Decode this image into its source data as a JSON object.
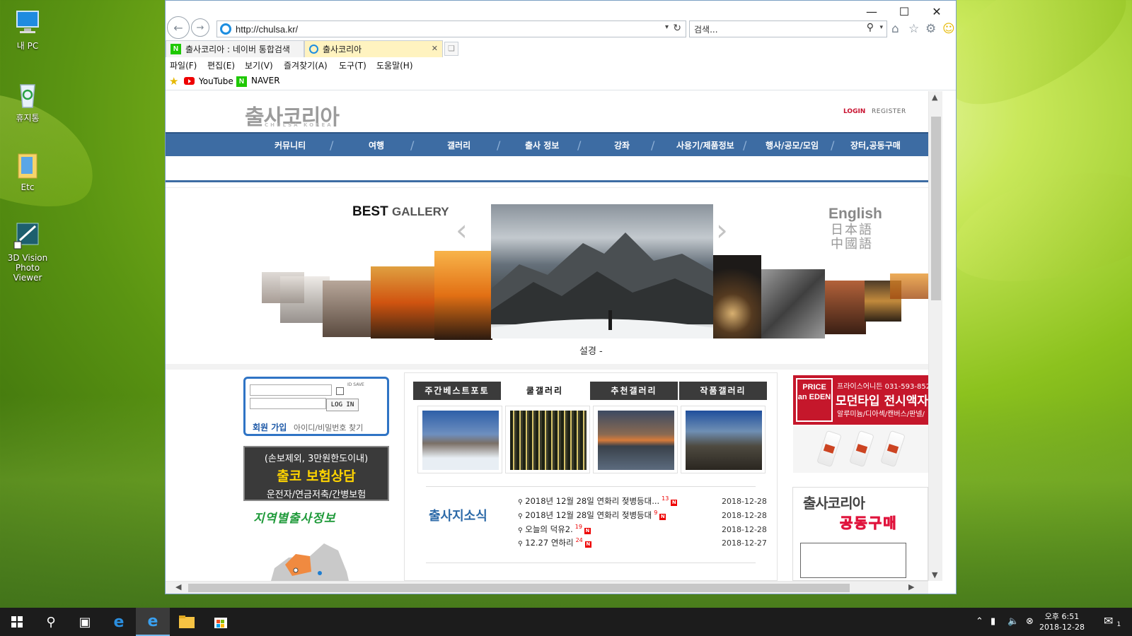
{
  "desktop": {
    "icons": [
      {
        "label": "내 PC",
        "icon": "monitor-icon"
      },
      {
        "label": "휴지통",
        "icon": "recycle-bin-icon"
      },
      {
        "label": "Etc",
        "icon": "folder-icon"
      },
      {
        "label": "3D Vision Photo Viewer",
        "icon": "3d-vision-icon"
      }
    ]
  },
  "browser": {
    "url": "http://chulsa.kr/",
    "search_placeholder": "검색...",
    "tabs": [
      {
        "label": "출사코리아 : 네이버 통합검색",
        "icon": "naver-icon",
        "active": false
      },
      {
        "label": "출사코리아",
        "icon": "ie-icon",
        "active": true
      }
    ],
    "menu": [
      "파일(F)",
      "편집(E)",
      "보기(V)",
      "즐겨찾기(A)",
      "도구(T)",
      "도움말(H)"
    ],
    "favorites": [
      {
        "label": "YouTube",
        "icon": "youtube-icon"
      },
      {
        "label": "NAVER",
        "icon": "naver-icon"
      }
    ]
  },
  "site": {
    "logo": "출사코리아",
    "logo_sub": "CHULSA KOREA",
    "login_link": "LOGIN",
    "register_link": "REGISTER",
    "nav": [
      "커뮤니티",
      "여행",
      "갤러리",
      "출사 정보",
      "강좌",
      "사용기/제품정보",
      "행사/공모/모임",
      "장터,공동구매"
    ],
    "gallery_title_bold": "BEST",
    "gallery_title_rest": "GALLERY",
    "gallery_caption": "설경 -",
    "languages": [
      "English",
      "日本語",
      "中國語"
    ],
    "login_box": {
      "id_save": "ID SAVE",
      "login_button": "LOG IN",
      "join": "회원 가입",
      "find": "아이디/비밀번호 찾기"
    },
    "insurance": {
      "line1": "(손보제외, 3만원한도이내)",
      "line2": "출코 보험상담",
      "line3": "운전자/연금저축/간병보험"
    },
    "region_title": "지역별출사정보",
    "gallery_tabs": [
      "주간베스트포토",
      "쿨갤러리",
      "추천갤러리",
      "작품갤러리"
    ],
    "news": {
      "title": "출사지소식",
      "items": [
        {
          "text": "2018년 12월 28일 연화리 젖병등대...",
          "count": "13",
          "date": "2018-12-28"
        },
        {
          "text": "2018년 12월 28일 연화리 젖병등대",
          "count": "9",
          "date": "2018-12-28"
        },
        {
          "text": "오늘의 덕유2.",
          "count": "19",
          "date": "2018-12-28"
        },
        {
          "text": "12.27 연하리",
          "count": "24",
          "date": "2018-12-27"
        }
      ]
    },
    "ads": {
      "price_box": "PRICE an EDEN",
      "price_phone": "프라이스어니든 031-593-852",
      "price_title": "모던타입 전시액자",
      "price_sub": "알루미늄/디아섹/캔버스/판넬/",
      "group_buy_title": "출사코리아",
      "group_buy_sub": "공동구매"
    }
  },
  "taskbar": {
    "time": "오후 6:51",
    "date": "2018-12-28",
    "notification_count": "1"
  }
}
